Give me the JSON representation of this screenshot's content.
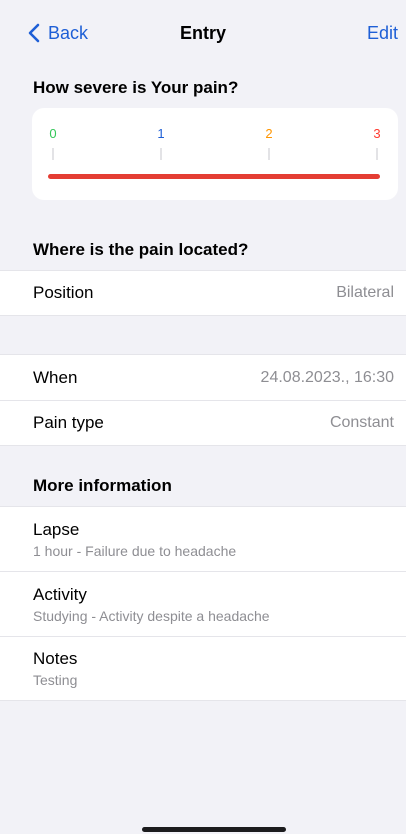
{
  "nav": {
    "back_label": "Back",
    "title": "Entry",
    "edit_label": "Edit"
  },
  "severity": {
    "question": "How severe is Your pain?",
    "ticks": [
      {
        "label": "0",
        "color": "#34c759"
      },
      {
        "label": "1",
        "color": "#1e5fd6"
      },
      {
        "label": "2",
        "color": "#ff9500"
      },
      {
        "label": "3",
        "color": "#ff3b30"
      }
    ],
    "selected_level": 3,
    "max_level": 3,
    "bar_color": "#e43d33"
  },
  "location": {
    "header": "Where is the pain located?",
    "position_label": "Position",
    "position_value": "Bilateral"
  },
  "details": {
    "when_label": "When",
    "when_value": "24.08.2023., 16:30",
    "type_label": "Pain type",
    "type_value": "Constant"
  },
  "more": {
    "header": "More information",
    "items": [
      {
        "title": "Lapse",
        "subtitle": "1 hour - Failure due to headache"
      },
      {
        "title": "Activity",
        "subtitle": "Studying - Activity despite a headache"
      },
      {
        "title": "Notes",
        "subtitle": "Testing"
      }
    ]
  },
  "colors": {
    "accent": "#1e5fd6",
    "background": "#f2f2f7"
  }
}
